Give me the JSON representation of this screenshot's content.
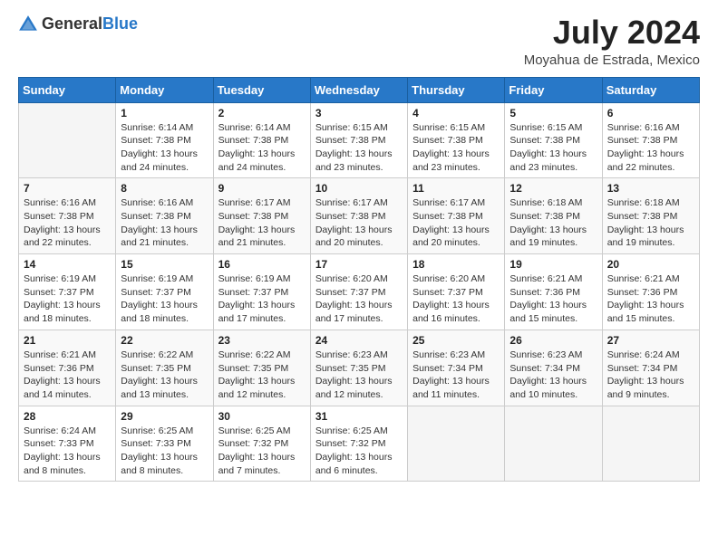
{
  "logo": {
    "text_general": "General",
    "text_blue": "Blue"
  },
  "title": "July 2024",
  "location": "Moyahua de Estrada, Mexico",
  "days_of_week": [
    "Sunday",
    "Monday",
    "Tuesday",
    "Wednesday",
    "Thursday",
    "Friday",
    "Saturday"
  ],
  "weeks": [
    [
      {
        "day": "",
        "sunrise": "",
        "sunset": "",
        "daylight": ""
      },
      {
        "day": "1",
        "sunrise": "Sunrise: 6:14 AM",
        "sunset": "Sunset: 7:38 PM",
        "daylight": "Daylight: 13 hours and 24 minutes."
      },
      {
        "day": "2",
        "sunrise": "Sunrise: 6:14 AM",
        "sunset": "Sunset: 7:38 PM",
        "daylight": "Daylight: 13 hours and 24 minutes."
      },
      {
        "day": "3",
        "sunrise": "Sunrise: 6:15 AM",
        "sunset": "Sunset: 7:38 PM",
        "daylight": "Daylight: 13 hours and 23 minutes."
      },
      {
        "day": "4",
        "sunrise": "Sunrise: 6:15 AM",
        "sunset": "Sunset: 7:38 PM",
        "daylight": "Daylight: 13 hours and 23 minutes."
      },
      {
        "day": "5",
        "sunrise": "Sunrise: 6:15 AM",
        "sunset": "Sunset: 7:38 PM",
        "daylight": "Daylight: 13 hours and 23 minutes."
      },
      {
        "day": "6",
        "sunrise": "Sunrise: 6:16 AM",
        "sunset": "Sunset: 7:38 PM",
        "daylight": "Daylight: 13 hours and 22 minutes."
      }
    ],
    [
      {
        "day": "7",
        "sunrise": "Sunrise: 6:16 AM",
        "sunset": "Sunset: 7:38 PM",
        "daylight": "Daylight: 13 hours and 22 minutes."
      },
      {
        "day": "8",
        "sunrise": "Sunrise: 6:16 AM",
        "sunset": "Sunset: 7:38 PM",
        "daylight": "Daylight: 13 hours and 21 minutes."
      },
      {
        "day": "9",
        "sunrise": "Sunrise: 6:17 AM",
        "sunset": "Sunset: 7:38 PM",
        "daylight": "Daylight: 13 hours and 21 minutes."
      },
      {
        "day": "10",
        "sunrise": "Sunrise: 6:17 AM",
        "sunset": "Sunset: 7:38 PM",
        "daylight": "Daylight: 13 hours and 20 minutes."
      },
      {
        "day": "11",
        "sunrise": "Sunrise: 6:17 AM",
        "sunset": "Sunset: 7:38 PM",
        "daylight": "Daylight: 13 hours and 20 minutes."
      },
      {
        "day": "12",
        "sunrise": "Sunrise: 6:18 AM",
        "sunset": "Sunset: 7:38 PM",
        "daylight": "Daylight: 13 hours and 19 minutes."
      },
      {
        "day": "13",
        "sunrise": "Sunrise: 6:18 AM",
        "sunset": "Sunset: 7:38 PM",
        "daylight": "Daylight: 13 hours and 19 minutes."
      }
    ],
    [
      {
        "day": "14",
        "sunrise": "Sunrise: 6:19 AM",
        "sunset": "Sunset: 7:37 PM",
        "daylight": "Daylight: 13 hours and 18 minutes."
      },
      {
        "day": "15",
        "sunrise": "Sunrise: 6:19 AM",
        "sunset": "Sunset: 7:37 PM",
        "daylight": "Daylight: 13 hours and 18 minutes."
      },
      {
        "day": "16",
        "sunrise": "Sunrise: 6:19 AM",
        "sunset": "Sunset: 7:37 PM",
        "daylight": "Daylight: 13 hours and 17 minutes."
      },
      {
        "day": "17",
        "sunrise": "Sunrise: 6:20 AM",
        "sunset": "Sunset: 7:37 PM",
        "daylight": "Daylight: 13 hours and 17 minutes."
      },
      {
        "day": "18",
        "sunrise": "Sunrise: 6:20 AM",
        "sunset": "Sunset: 7:37 PM",
        "daylight": "Daylight: 13 hours and 16 minutes."
      },
      {
        "day": "19",
        "sunrise": "Sunrise: 6:21 AM",
        "sunset": "Sunset: 7:36 PM",
        "daylight": "Daylight: 13 hours and 15 minutes."
      },
      {
        "day": "20",
        "sunrise": "Sunrise: 6:21 AM",
        "sunset": "Sunset: 7:36 PM",
        "daylight": "Daylight: 13 hours and 15 minutes."
      }
    ],
    [
      {
        "day": "21",
        "sunrise": "Sunrise: 6:21 AM",
        "sunset": "Sunset: 7:36 PM",
        "daylight": "Daylight: 13 hours and 14 minutes."
      },
      {
        "day": "22",
        "sunrise": "Sunrise: 6:22 AM",
        "sunset": "Sunset: 7:35 PM",
        "daylight": "Daylight: 13 hours and 13 minutes."
      },
      {
        "day": "23",
        "sunrise": "Sunrise: 6:22 AM",
        "sunset": "Sunset: 7:35 PM",
        "daylight": "Daylight: 13 hours and 12 minutes."
      },
      {
        "day": "24",
        "sunrise": "Sunrise: 6:23 AM",
        "sunset": "Sunset: 7:35 PM",
        "daylight": "Daylight: 13 hours and 12 minutes."
      },
      {
        "day": "25",
        "sunrise": "Sunrise: 6:23 AM",
        "sunset": "Sunset: 7:34 PM",
        "daylight": "Daylight: 13 hours and 11 minutes."
      },
      {
        "day": "26",
        "sunrise": "Sunrise: 6:23 AM",
        "sunset": "Sunset: 7:34 PM",
        "daylight": "Daylight: 13 hours and 10 minutes."
      },
      {
        "day": "27",
        "sunrise": "Sunrise: 6:24 AM",
        "sunset": "Sunset: 7:34 PM",
        "daylight": "Daylight: 13 hours and 9 minutes."
      }
    ],
    [
      {
        "day": "28",
        "sunrise": "Sunrise: 6:24 AM",
        "sunset": "Sunset: 7:33 PM",
        "daylight": "Daylight: 13 hours and 8 minutes."
      },
      {
        "day": "29",
        "sunrise": "Sunrise: 6:25 AM",
        "sunset": "Sunset: 7:33 PM",
        "daylight": "Daylight: 13 hours and 8 minutes."
      },
      {
        "day": "30",
        "sunrise": "Sunrise: 6:25 AM",
        "sunset": "Sunset: 7:32 PM",
        "daylight": "Daylight: 13 hours and 7 minutes."
      },
      {
        "day": "31",
        "sunrise": "Sunrise: 6:25 AM",
        "sunset": "Sunset: 7:32 PM",
        "daylight": "Daylight: 13 hours and 6 minutes."
      },
      {
        "day": "",
        "sunrise": "",
        "sunset": "",
        "daylight": ""
      },
      {
        "day": "",
        "sunrise": "",
        "sunset": "",
        "daylight": ""
      },
      {
        "day": "",
        "sunrise": "",
        "sunset": "",
        "daylight": ""
      }
    ]
  ]
}
